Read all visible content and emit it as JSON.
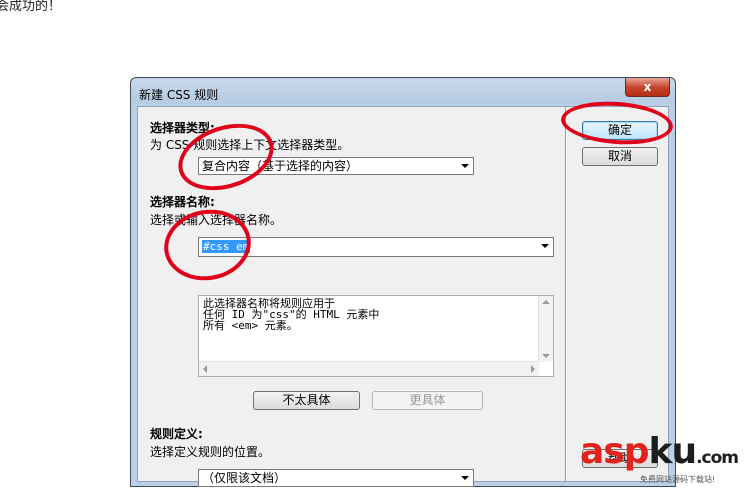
{
  "page": {
    "top_text": "会成功的！"
  },
  "dialog": {
    "title": "新建 CSS 规则",
    "close_glyph": "x",
    "selector_type": {
      "heading": "选择器类型:",
      "hint": "为 CSS 规则选择上下文选择器类型。",
      "selected": "复合内容（基于选择的内容）"
    },
    "selector_name": {
      "heading": "选择器名称:",
      "hint": "选择或输入选择器名称。",
      "value": "#css em",
      "description": "此选择器名称将规则应用于\n任何 ID 为\"css\"的 HTML 元素中\n所有 <em> 元素。"
    },
    "buttons": {
      "less_specific": "不太具体",
      "more_specific": "更具体",
      "ok": "确定",
      "cancel": "取消",
      "help": "帮助"
    },
    "rule_definition": {
      "heading": "规则定义:",
      "hint": "选择定义规则的位置。",
      "selected": "（仅限该文档）"
    }
  },
  "watermark": {
    "part1": "asp",
    "part2": "ku",
    "part3": ".com",
    "sub": "免费网站源码下载站!"
  },
  "colors": {
    "highlight_circle": "#e0001a",
    "selection": "#3399ff",
    "watermark_red": "#e0231b"
  }
}
